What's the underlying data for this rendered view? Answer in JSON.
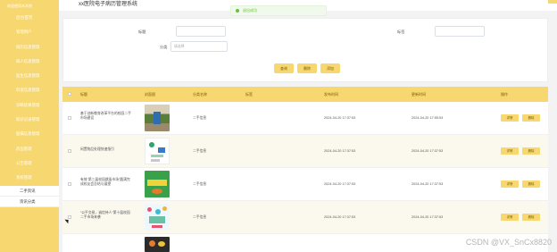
{
  "topbar": {
    "title": "xx医院电子病历管理系统"
  },
  "sidebar": {
    "top_label": "欢迎使用本系统",
    "items": [
      {
        "label": "后台首页"
      },
      {
        "label": "管理用户"
      },
      {
        "label": "病历信息管理"
      },
      {
        "label": "病人信息管理"
      },
      {
        "label": "医生信息管理"
      },
      {
        "label": "科室信息管理"
      },
      {
        "label": "诊断结果管理"
      },
      {
        "label": "就诊记录管理"
      },
      {
        "label": "医嘱信息管理"
      },
      {
        "label": "药品管理"
      },
      {
        "label": "公告管理"
      },
      {
        "label": "系统管理"
      }
    ],
    "sub_items": [
      {
        "label": "二手资讯"
      },
      {
        "label": "资讯分类"
      }
    ]
  },
  "toast": {
    "text": "退出成功"
  },
  "search": {
    "title_label": "标题",
    "title_value": "",
    "tag_label": "标签",
    "tag_value": "",
    "category_label": "分类",
    "category_placeholder": "请选择",
    "buttons": {
      "query": "查询",
      "delete": "删除",
      "add": "添加"
    }
  },
  "table": {
    "headers": [
      "标题",
      "封面图",
      "分类名称",
      "标签",
      "发布时间",
      "更新时间",
      "操作"
    ],
    "rows": [
      {
        "title": "基于创新教育改革平台的校园二手市场建设",
        "category": "二手信息",
        "tag": "",
        "published": "2024-04-20 17:37:53",
        "updated": "2024-04-20 17:55:53",
        "edit": "详情",
        "delete": "删除"
      },
      {
        "title": "闲置物品处理快速指引",
        "category": "二手信息",
        "tag": "",
        "published": "2024-04-20 17:37:53",
        "updated": "2024-04-20 17:37:53",
        "edit": "详情",
        "delete": "删除"
      },
      {
        "title": "有效“第三届校园跳蚤市场”圆满完成校友会总结与展望",
        "category": "二手信息",
        "tag": "",
        "published": "2024-04-20 17:37:53",
        "updated": "2024-04-20 17:37:53",
        "edit": "详情",
        "delete": "删除"
      },
      {
        "title": "“公平交易，诚信待人”第十届校园二手市场来袭",
        "category": "二手信息",
        "tag": "",
        "published": "2024-04-20 17:37:53",
        "updated": "2024-04-20 17:37:53",
        "edit": "详情",
        "delete": "删除"
      }
    ]
  },
  "watermark": "CSDN @VX_SnCx8820",
  "colors": {
    "accent": "#f7d770",
    "sidebar": "#f7d770",
    "success": "#67c23a"
  }
}
